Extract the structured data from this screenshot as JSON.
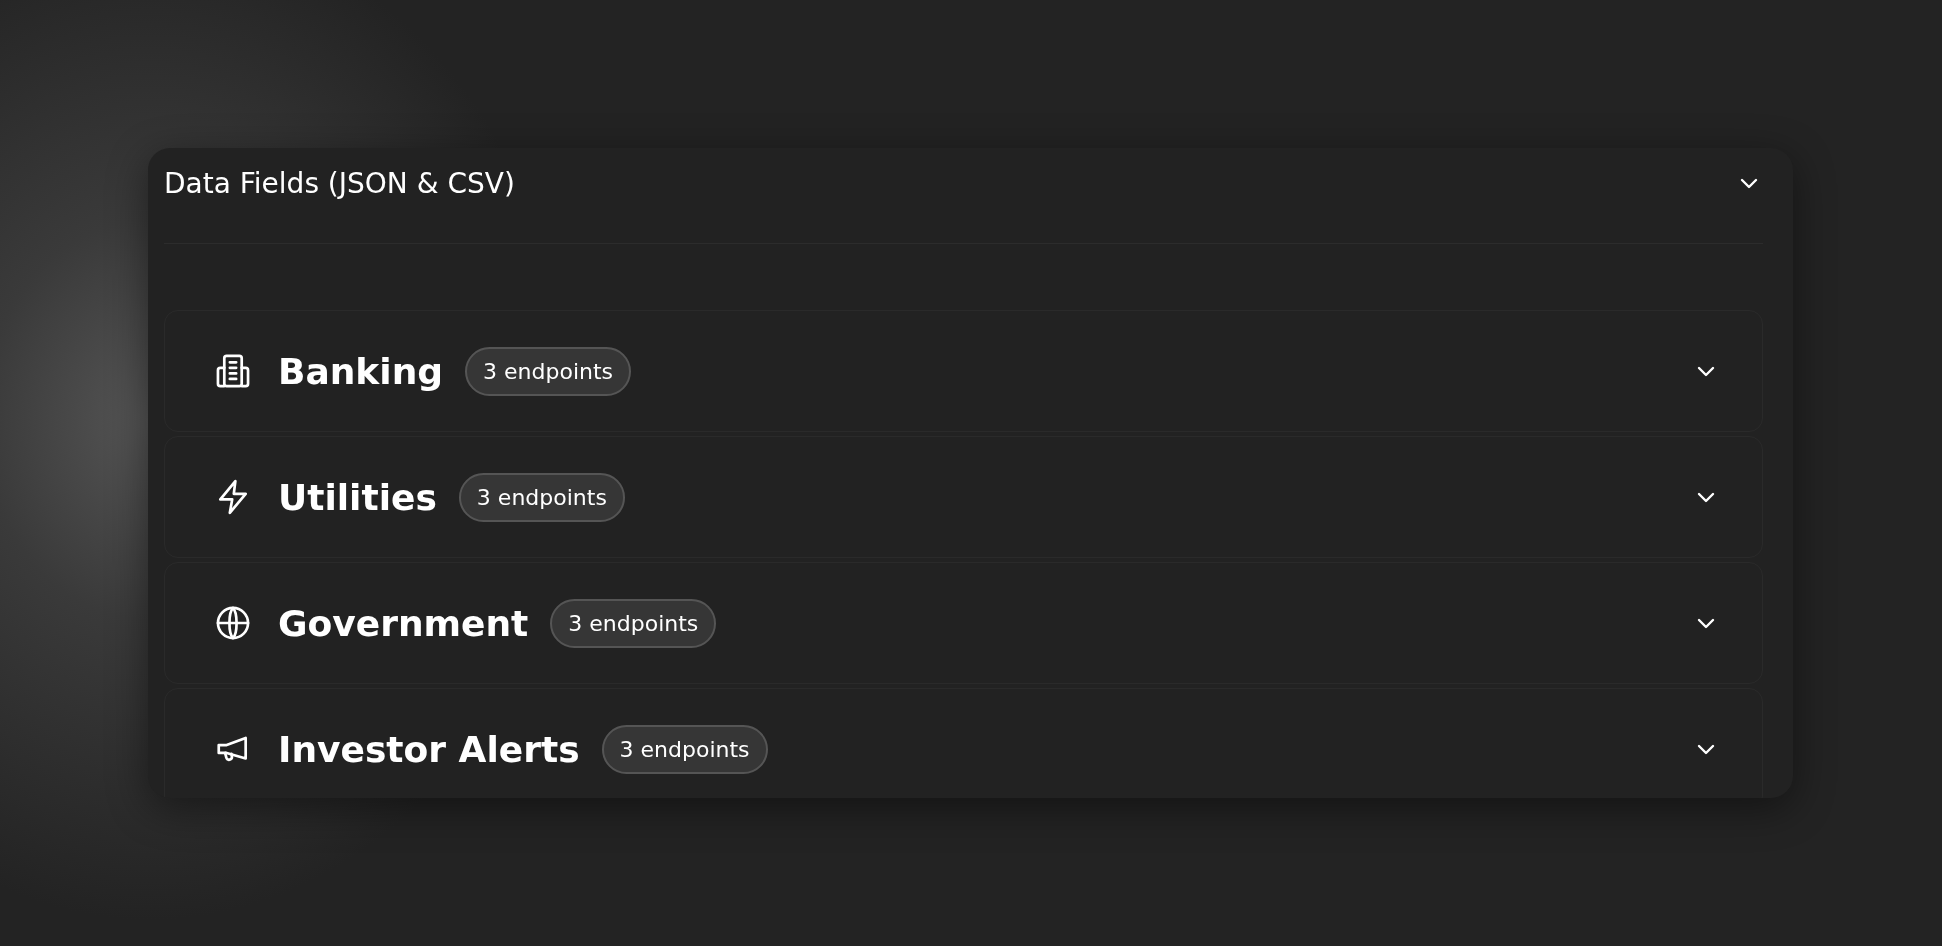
{
  "panel": {
    "title": "Data Fields (JSON & CSV)"
  },
  "categories": [
    {
      "name": "Banking",
      "badge": "3 endpoints"
    },
    {
      "name": "Utilities",
      "badge": "3 endpoints"
    },
    {
      "name": "Government",
      "badge": "3 endpoints"
    },
    {
      "name": "Investor Alerts",
      "badge": "3 endpoints"
    }
  ]
}
